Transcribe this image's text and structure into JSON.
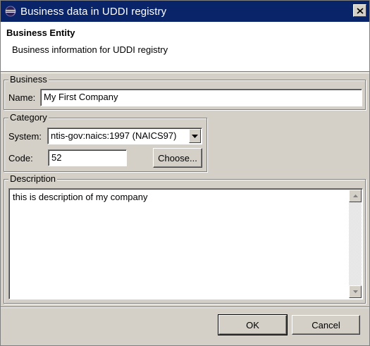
{
  "window": {
    "title": "Business data in UDDI registry",
    "icon": "eclipse-icon",
    "close_icon": "close-icon"
  },
  "header": {
    "title": "Business Entity",
    "description": "Business information for UDDI registry"
  },
  "business": {
    "legend": "Business",
    "name_label": "Name:",
    "name_value": "My First Company"
  },
  "category": {
    "legend": "Category",
    "system_label": "System:",
    "system_value": "ntis-gov:naics:1997 (NAICS97)",
    "code_label": "Code:",
    "code_value": "52",
    "choose_label": "Choose..."
  },
  "description": {
    "legend": "Description",
    "value": "this is description of my company"
  },
  "buttons": {
    "ok": "OK",
    "cancel": "Cancel"
  }
}
